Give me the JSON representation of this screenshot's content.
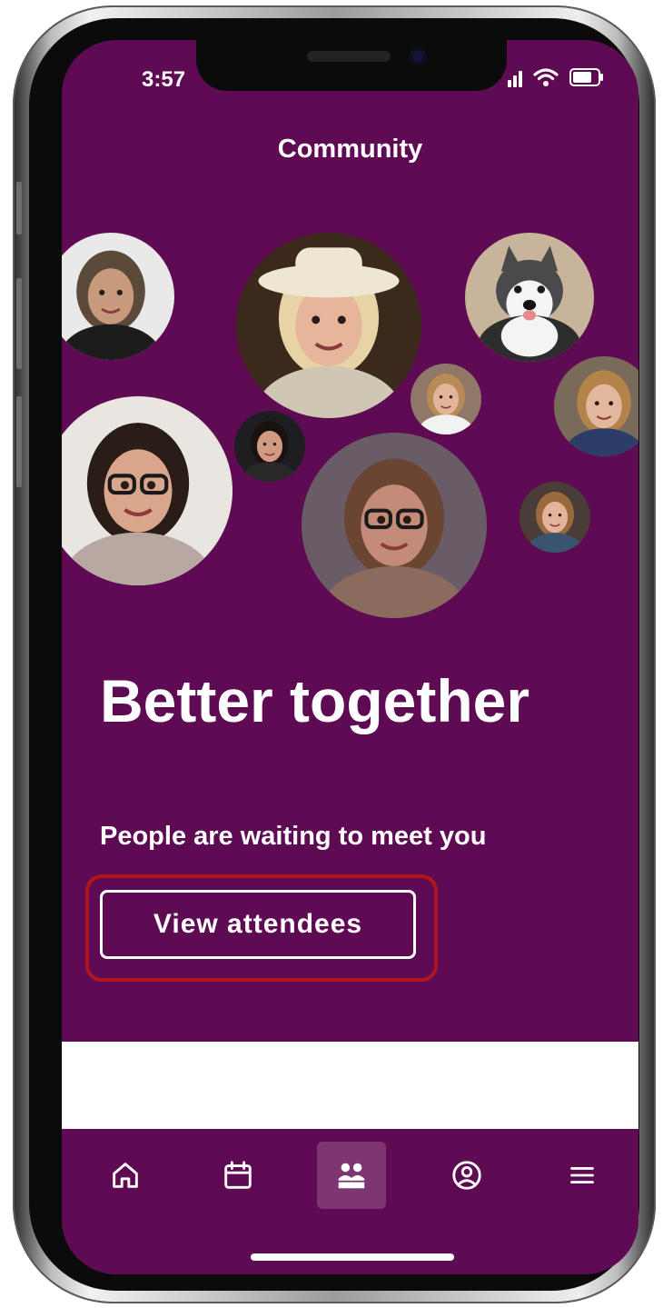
{
  "status_bar": {
    "time": "3:57"
  },
  "header": {
    "title": "Community"
  },
  "avatars": [
    {
      "name": "avatar-man-black-shirt",
      "bg": "#e9e9e9",
      "skin": "#c79a7c",
      "hair": "#5b4a3a",
      "shirt": "#1c1c1c"
    },
    {
      "name": "avatar-woman-white-hat",
      "bg": "#3b2a1c",
      "skin": "#e7b59b",
      "hair": "#e6d3a6",
      "shirt": "#cfc7b3"
    },
    {
      "name": "avatar-husky-dog",
      "bg": "#c7b49a",
      "skin": "#f4f4f4",
      "hair": "#4a4a4a",
      "shirt": "#2d2d2d"
    },
    {
      "name": "avatar-woman-blonde-small",
      "bg": "#8f7868",
      "skin": "#e0b59a",
      "hair": "#b88a55",
      "shirt": "#f2f2f2"
    },
    {
      "name": "avatar-woman-blue-top",
      "bg": "#7a6a5a",
      "skin": "#e3b79b",
      "hair": "#b3834c",
      "shirt": "#2e3d68"
    },
    {
      "name": "avatar-woman-glasses-curly",
      "bg": "#e9e6e2",
      "skin": "#d9a58b",
      "hair": "#2a1c16",
      "shirt": "#b9a7a1"
    },
    {
      "name": "avatar-woman-dark-hair-small",
      "bg": "#1e1e22",
      "skin": "#d19b83",
      "hair": "#1a1210",
      "shirt": "#282828"
    },
    {
      "name": "avatar-woman-large-glasses",
      "bg": "#6a5c66",
      "skin": "#c48b78",
      "hair": "#6a4632",
      "shirt": "#8b6b5e"
    },
    {
      "name": "avatar-woman-floral-top",
      "bg": "#4a3c36",
      "skin": "#e4b39b",
      "hair": "#9a6a3e",
      "shirt": "#3a5470"
    }
  ],
  "hero": {
    "title": "Better together",
    "subtitle": "People are waiting to meet you",
    "cta_label": "View attendees"
  },
  "tabbar": {
    "items": [
      {
        "name": "home",
        "icon": "home-icon",
        "active": false
      },
      {
        "name": "schedule",
        "icon": "calendar-icon",
        "active": false
      },
      {
        "name": "community",
        "icon": "people-icon",
        "active": true
      },
      {
        "name": "profile",
        "icon": "user-circle-icon",
        "active": false
      },
      {
        "name": "menu",
        "icon": "hamburger-menu-icon",
        "active": false
      }
    ]
  },
  "colors": {
    "brand_purple": "#5e0b53",
    "active_tab": "#7d3672",
    "highlight_annotation": "#b0141d",
    "text": "#ffffff"
  }
}
